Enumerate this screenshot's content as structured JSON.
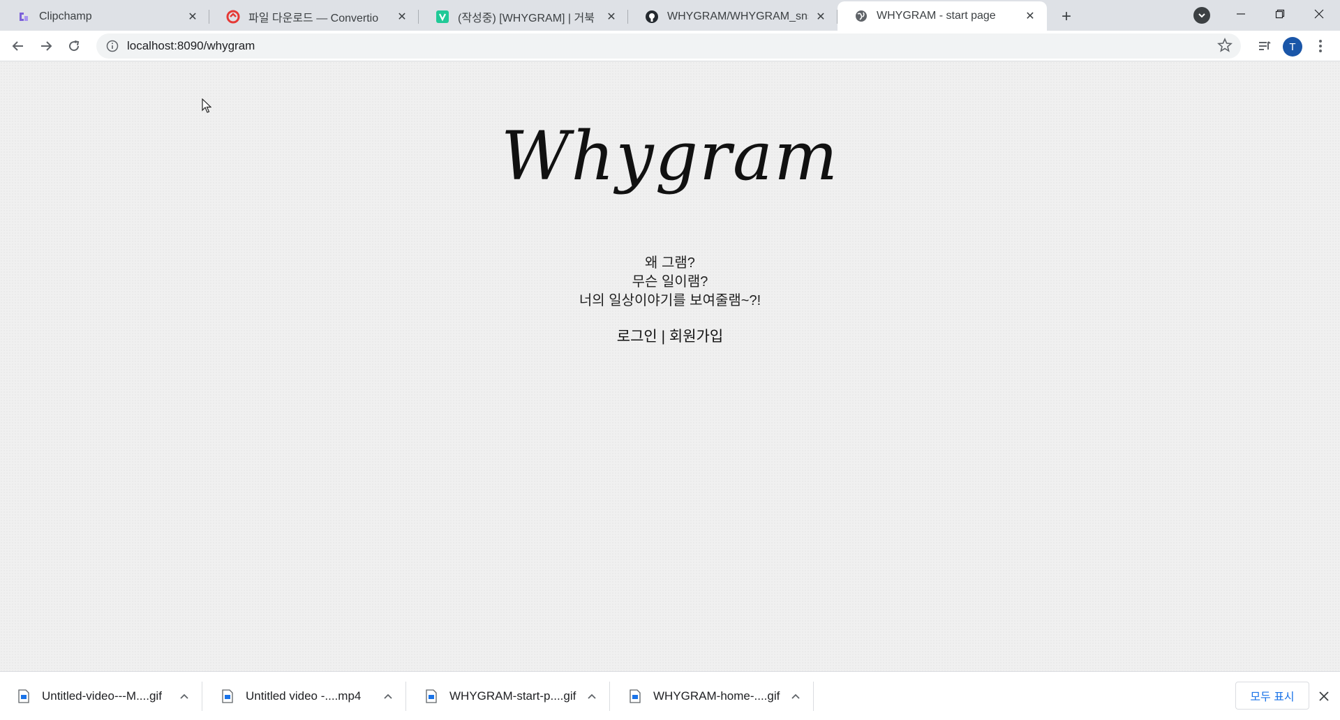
{
  "browser": {
    "tabs": [
      {
        "title": "Clipchamp",
        "favicon": "clipchamp-icon",
        "active": false
      },
      {
        "title": "파일 다운로드 — Convertio",
        "favicon": "convertio-icon",
        "active": false
      },
      {
        "title": "(작성중) [WHYGRAM] | 거북",
        "favicon": "velog-icon",
        "active": false
      },
      {
        "title": "WHYGRAM/WHYGRAM_sns",
        "favicon": "github-icon",
        "active": false
      },
      {
        "title": "WHYGRAM - start page",
        "favicon": "globe-icon",
        "active": true
      }
    ],
    "url": "localhost:8090/whygram",
    "profile_initial": "T"
  },
  "page": {
    "logo_text": "Whygram",
    "intro_lines": [
      "왜 그램?",
      "무슨 일이램?",
      "너의 일상이야기를 보여줄램~?!"
    ],
    "login_label": "로그인",
    "divider": "|",
    "signup_label": "회원가입"
  },
  "downloads": {
    "items": [
      {
        "name": "Untitled-video---M....gif"
      },
      {
        "name": "Untitled video -....mp4"
      },
      {
        "name": "WHYGRAM-start-p....gif"
      },
      {
        "name": "WHYGRAM-home-....gif"
      }
    ],
    "show_all_label": "모두 표시"
  },
  "colors": {
    "tabstrip_bg": "#dee1e6",
    "page_bg": "#f0f0f0",
    "accent_blue": "#1a73e8",
    "avatar_bg": "#1a56a8"
  }
}
